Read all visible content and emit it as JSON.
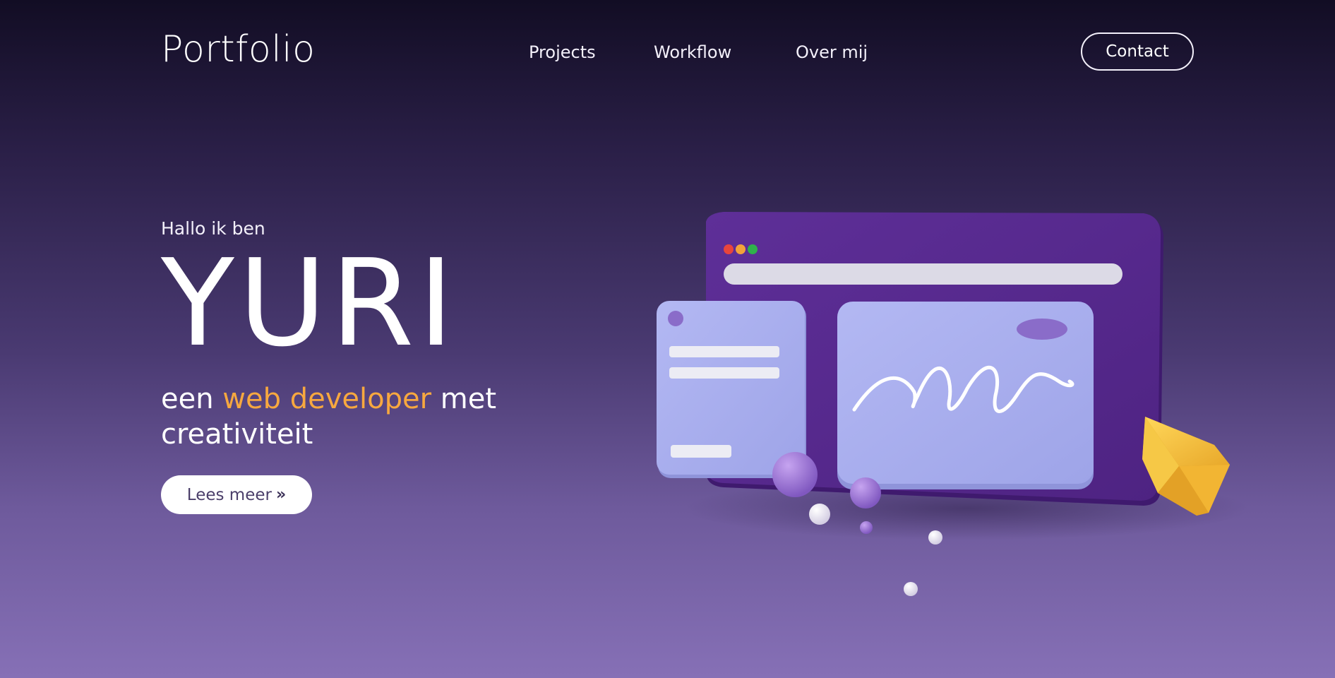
{
  "header": {
    "logo": "Portfolio",
    "nav": [
      {
        "label": "Projects"
      },
      {
        "label": "Workflow"
      },
      {
        "label": "Over mij"
      }
    ],
    "contact_label": "Contact"
  },
  "hero": {
    "greeting": "Hallo ik ben",
    "name": "YURI",
    "tagline_before": "een",
    "tagline_accent": "web developer",
    "tagline_after": "met creativiteit",
    "button_label": "Lees meer",
    "button_icon": "double-chevron-right-icon"
  },
  "illustration": {
    "name": "3d-browser-window-illustration"
  },
  "colors": {
    "accent": "#f7a83f",
    "background_top": "#120d24",
    "background_bottom": "#8670b6",
    "window_purple": "#5a2c91",
    "card_lavender": "#a8aeee",
    "gem_yellow": "#f5c13b"
  }
}
